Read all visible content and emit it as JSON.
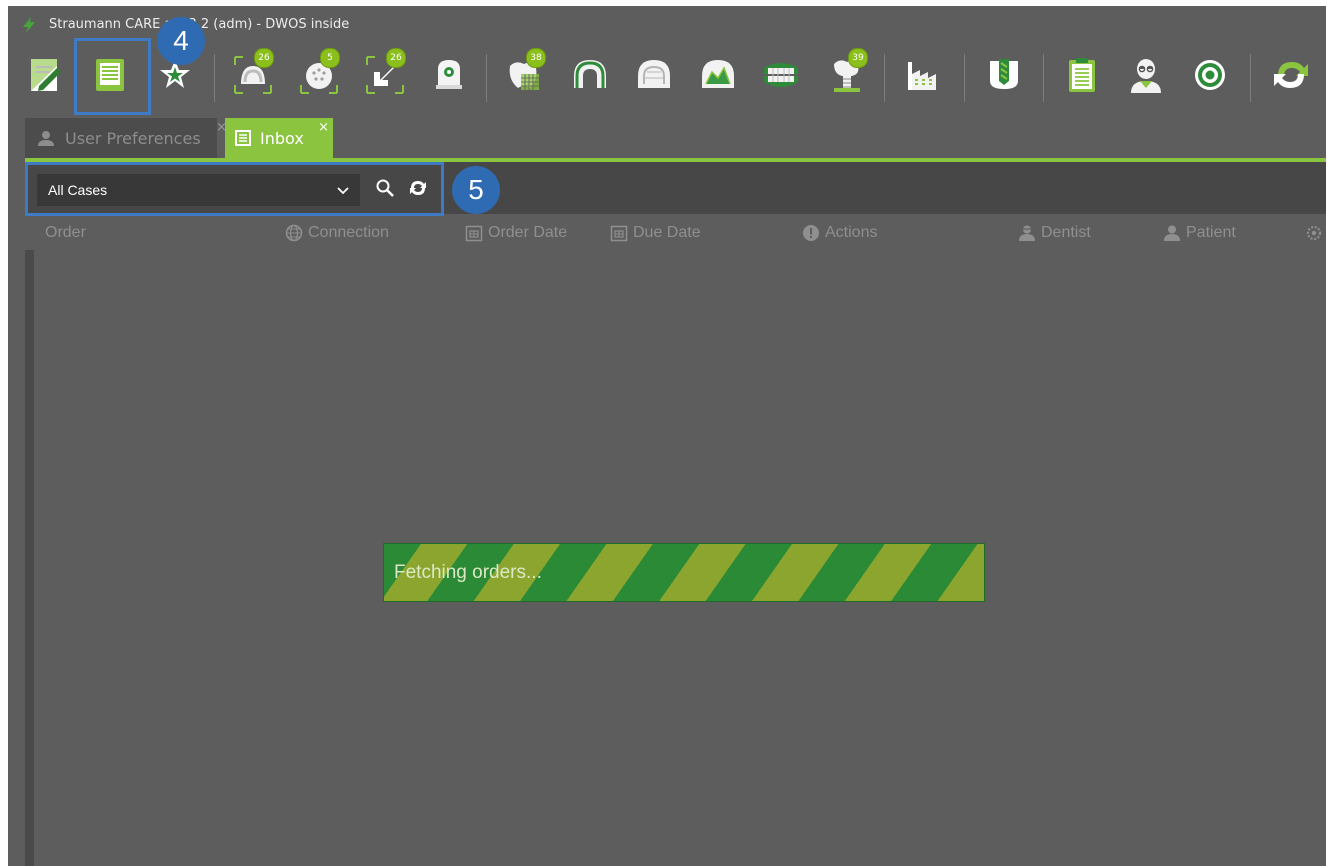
{
  "window": {
    "title": "Straumann CARE    al 13.2  (adm) - DWOS inside"
  },
  "toolbar": {
    "buttons": [
      {
        "icon": "edit-order-icon",
        "badge": ""
      },
      {
        "icon": "inbox-icon",
        "badge": ""
      },
      {
        "icon": "favorites-star-icon",
        "badge": ""
      },
      {
        "icon": "scan-model-icon",
        "badge": "26"
      },
      {
        "icon": "scan-impression-icon",
        "badge": "5"
      },
      {
        "icon": "import-scan-icon",
        "badge": "26"
      },
      {
        "icon": "scanner-device-icon",
        "badge": ""
      },
      {
        "icon": "crown-design-icon",
        "badge": "38"
      },
      {
        "icon": "arch-design-icon",
        "badge": ""
      },
      {
        "icon": "full-arch-icon",
        "badge": ""
      },
      {
        "icon": "partial-framework-icon",
        "badge": ""
      },
      {
        "icon": "denture-icon",
        "badge": ""
      },
      {
        "icon": "implant-abutment-icon",
        "badge": "39"
      },
      {
        "icon": "milling-facility-icon",
        "badge": ""
      },
      {
        "icon": "milling-block-icon",
        "badge": ""
      },
      {
        "icon": "report-clipboard-icon",
        "badge": ""
      },
      {
        "icon": "user-profile-icon",
        "badge": ""
      },
      {
        "icon": "settings-gear-icon",
        "badge": ""
      },
      {
        "icon": "sync-refresh-icon",
        "badge": ""
      }
    ]
  },
  "tabs": [
    {
      "label": "User Preferences",
      "close": "×",
      "icon": "user-icon"
    },
    {
      "label": "Inbox",
      "close": "×",
      "icon": "inbox-tab-icon"
    }
  ],
  "filter": {
    "selected": "All Cases",
    "search_icon": "search-icon",
    "refresh_icon": "refresh-icon"
  },
  "columns": [
    {
      "label": "Order",
      "icon": ""
    },
    {
      "label": "Connection",
      "icon": "globe-icon"
    },
    {
      "label": "Order Date",
      "icon": "calendar-icon"
    },
    {
      "label": "Due Date",
      "icon": "calendar-icon"
    },
    {
      "label": "Actions",
      "icon": "alert-circle-icon"
    },
    {
      "label": "Dentist",
      "icon": "dentist-icon"
    },
    {
      "label": "Patient",
      "icon": "patient-icon"
    },
    {
      "label": "",
      "icon": "settings-column-icon"
    }
  ],
  "progress": {
    "text": "Fetching orders...",
    "fraction": 1.0
  },
  "callouts": {
    "first": "4",
    "second": "5"
  },
  "colors": {
    "brand_green": "#8bc53f",
    "callout_blue": "#2f6bb3",
    "background": "#5d5d5d",
    "progress_stripe_light": "#8ba52f",
    "progress_stripe_dark": "#2b8a35"
  }
}
